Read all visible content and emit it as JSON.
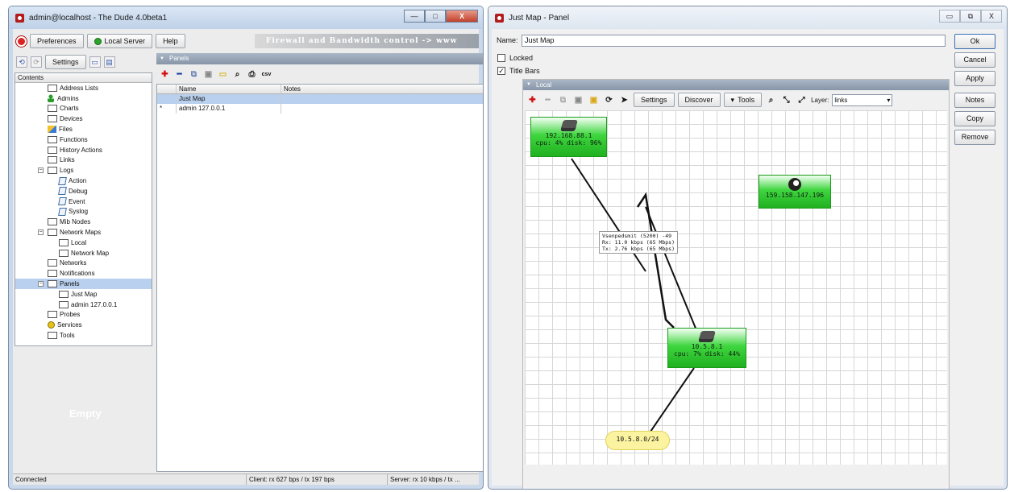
{
  "left_window": {
    "title": "admin@localhost - The Dude 4.0beta1",
    "buttons": {
      "minimize": "—",
      "maximize": "□",
      "close": "X"
    },
    "toolbar": {
      "preferences": "Preferences",
      "local_server": "Local Server",
      "help": "Help",
      "banner": "Firewall and Bandwidth control -> www"
    },
    "toolbar2": {
      "settings": "Settings"
    },
    "tree": {
      "header": "Contents",
      "items": [
        {
          "label": "Address Lists",
          "icon": "box"
        },
        {
          "label": "Admins",
          "icon": "admin"
        },
        {
          "label": "Charts",
          "icon": "box"
        },
        {
          "label": "Devices",
          "icon": "box"
        },
        {
          "label": "Files",
          "icon": "files"
        },
        {
          "label": "Functions",
          "icon": "box"
        },
        {
          "label": "History Actions",
          "icon": "box"
        },
        {
          "label": "Links",
          "icon": "box"
        },
        {
          "label": "Logs",
          "icon": "box"
        },
        {
          "label": "Action",
          "icon": "log"
        },
        {
          "label": "Debug",
          "icon": "log"
        },
        {
          "label": "Event",
          "icon": "log"
        },
        {
          "label": "Syslog",
          "icon": "log"
        },
        {
          "label": "Mib Nodes",
          "icon": "box"
        },
        {
          "label": "Network Maps",
          "icon": "box"
        },
        {
          "label": "Local",
          "icon": "box"
        },
        {
          "label": "Network Map",
          "icon": "box"
        },
        {
          "label": "Networks",
          "icon": "box"
        },
        {
          "label": "Notifications",
          "icon": "box"
        },
        {
          "label": "Panels",
          "icon": "box"
        },
        {
          "label": "Just Map",
          "icon": "box"
        },
        {
          "label": "admin 127.0.0.1",
          "icon": "box"
        },
        {
          "label": "Probes",
          "icon": "box"
        },
        {
          "label": "Services",
          "icon": "svc"
        },
        {
          "label": "Tools",
          "icon": "box"
        }
      ]
    },
    "empty_label": "Empty",
    "panels": {
      "title": "Panels",
      "columns": [
        "Name",
        "Notes"
      ],
      "rows": [
        {
          "marker": "",
          "name": "Just Map",
          "notes": ""
        },
        {
          "marker": "*",
          "name": "admin 127.0.0.1",
          "notes": ""
        }
      ],
      "toolbar_csv": "csv"
    },
    "status": {
      "connection": "Connected",
      "client": "Client: rx 627 bps / tx 197 bps",
      "server": "Server: rx 10 kbps / tx ..."
    }
  },
  "right_window": {
    "title": "Just Map - Panel",
    "name_label": "Name:",
    "name_value": "Just Map",
    "locked_label": "Locked",
    "locked_checked": false,
    "titlebars_label": "Title Bars",
    "titlebars_checked": true,
    "side_buttons": {
      "ok": "Ok",
      "cancel": "Cancel",
      "apply": "Apply",
      "notes": "Notes",
      "copy": "Copy",
      "remove": "Remove"
    },
    "map": {
      "title": "Local",
      "toolbar": {
        "settings": "Settings",
        "discover": "Discover",
        "tools": "Tools",
        "layer_label": "Layer:",
        "layer_value": "links"
      },
      "devices": [
        {
          "name": "192.168.88.1",
          "stats": "cpu: 4% disk: 96%",
          "icon": "router-icon"
        },
        {
          "name": "159.158.147.196",
          "stats": "",
          "icon": "globe-icon"
        },
        {
          "name": "10.5.8.1",
          "stats": "cpu: 7% disk: 44%",
          "icon": "router-icon"
        }
      ],
      "network": "10.5.8.0/24",
      "link_label": [
        "Vsenpedsmit (5200) -49",
        "Rx: 11.0 kbps (65 Mbps)",
        "Tx: 2.76 kbps (65 Mbps)"
      ]
    }
  }
}
